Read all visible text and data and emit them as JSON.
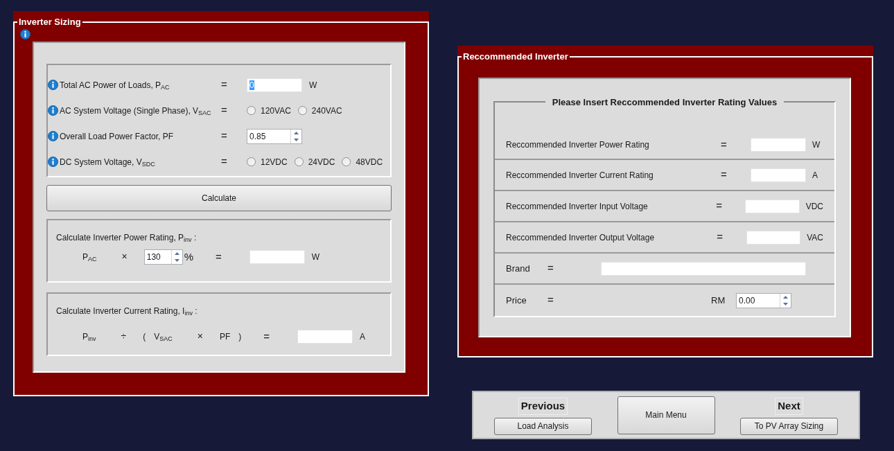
{
  "inverter_sizing": {
    "title": "Inverter Sizing",
    "inputs": [
      {
        "label": "Total AC Power of Loads, P$_{AC}$",
        "equals": "=",
        "kind": "field",
        "value": "0",
        "value_selected": true,
        "unit": "W"
      },
      {
        "label": "AC System Voltage (Single Phase), V$_{SAC}$",
        "equals": "=",
        "kind": "radios",
        "options": [
          {
            "label": "120VAC",
            "selected": false
          },
          {
            "label": "240VAC",
            "selected": false
          }
        ]
      },
      {
        "label": "Overall Load Power Factor, PF",
        "equals": "=",
        "kind": "spinner",
        "value": "0.85"
      },
      {
        "label": "DC System Voltage,   V$_{SDC}$",
        "equals": "=",
        "kind": "radios",
        "options": [
          {
            "label": "12VDC",
            "selected": false
          },
          {
            "label": "24VDC",
            "selected": false
          },
          {
            "label": "48VDC",
            "selected": false
          }
        ]
      }
    ],
    "calculate_button": "Calculate",
    "calculations": [
      {
        "title": "Calculate Inverter Power Rating, P$_{inv}$ :",
        "formula": [
          {
            "kind": "term",
            "text": "P$_{AC}$"
          },
          {
            "kind": "operator",
            "text": "×"
          },
          {
            "kind": "spinner",
            "value": "130"
          },
          {
            "kind": "term",
            "text": "%"
          },
          {
            "kind": "equals",
            "text": "="
          },
          {
            "kind": "field"
          },
          {
            "kind": "unit",
            "text": "W"
          }
        ]
      },
      {
        "title": "Calculate Inverter Current Rating, I$_{inv}$ :",
        "formula": [
          {
            "kind": "term",
            "text": "P$_{inv}$"
          },
          {
            "kind": "operator",
            "text": "÷"
          },
          {
            "kind": "term",
            "text": "("
          },
          {
            "kind": "term",
            "text": "V$_{SAC}$"
          },
          {
            "kind": "operator",
            "text": "×"
          },
          {
            "kind": "term",
            "text": "PF"
          },
          {
            "kind": "term",
            "text": ")"
          },
          {
            "kind": "equals",
            "text": "="
          },
          {
            "kind": "field"
          },
          {
            "kind": "unit",
            "text": "A"
          }
        ]
      }
    ]
  },
  "recommended_inverter": {
    "title": "Reccommended Inverter",
    "group_title": "Please Insert Reccommended Inverter Rating Values",
    "rows": [
      {
        "kind": "field",
        "label": "Reccommended Inverter Power Rating",
        "equals": "=",
        "unit": "W"
      },
      {
        "kind": "field",
        "label": "Reccommended Inverter Current Rating",
        "equals": "=",
        "unit": "A"
      },
      {
        "kind": "field",
        "label": "Reccommended Inverter Input Voltage",
        "equals": "=",
        "unit": "VDC"
      },
      {
        "kind": "field",
        "label": "Reccommended Inverter Output Voltage",
        "equals": "=",
        "unit": "VAC"
      },
      {
        "kind": "wide_field",
        "label": "Brand",
        "equals": "="
      },
      {
        "kind": "spinner",
        "label": "Price",
        "equals": "=",
        "currency": "RM",
        "value": "0.00"
      }
    ]
  },
  "navigation": {
    "previous": {
      "heading": "Previous",
      "button": "Load Analysis"
    },
    "main_menu": "Main Menu",
    "next": {
      "heading": "Next",
      "button": "To PV Array Sizing"
    }
  }
}
